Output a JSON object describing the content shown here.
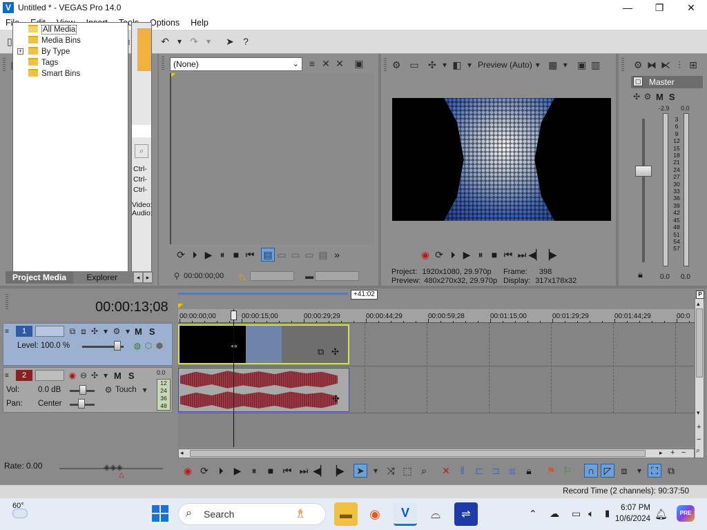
{
  "window": {
    "title": "Untitled * - VEGAS Pro 14.0",
    "logo": "V",
    "minimize_glyph": "—",
    "maximize_glyph": "❐",
    "close_glyph": "✕"
  },
  "menu": [
    "File",
    "Edit",
    "View",
    "Insert",
    "Tools",
    "Options",
    "Help"
  ],
  "toolbar_icons": [
    "new-icon",
    "open-icon",
    "save-icon",
    "save-as-icon",
    "render-icon",
    "properties-icon",
    "cut-icon",
    "copy-icon",
    "paste-icon",
    "undo-icon",
    "redo-icon",
    "cursor-icon",
    "help-icon"
  ],
  "project_media": {
    "tree": [
      {
        "label": "All Media",
        "selected": true
      },
      {
        "label": "Media Bins"
      },
      {
        "label": "By Type",
        "expand": "+"
      },
      {
        "label": "Tags"
      },
      {
        "label": "Smart Bins"
      }
    ],
    "thumb_lines": [
      "Ctrl-",
      "Ctrl-",
      "Ctrl-"
    ],
    "video_label": "Video:",
    "audio_label": "Audio:",
    "tabs": [
      "Project Media",
      "Explorer"
    ]
  },
  "trimmer": {
    "selector": "(None)",
    "timecode": "00:00:00;00"
  },
  "preview": {
    "mode": "Preview (Auto)",
    "project_label": "Project:",
    "project_value": "1920x1080, 29.970p",
    "preview_label": "Preview:",
    "preview_value": "480x270x32, 29.970p",
    "frame_label": "Frame:",
    "frame_value": "398",
    "display_label": "Display:",
    "display_value": "317x178x32"
  },
  "mixer": {
    "master": "Master",
    "m": "M",
    "s": "S",
    "peak_left": "-2.9",
    "peak_right": "0.0",
    "scale": [
      "3",
      "6",
      "9",
      "12",
      "15",
      "18",
      "21",
      "24",
      "27",
      "30",
      "33",
      "36",
      "39",
      "42",
      "45",
      "48",
      "51",
      "54",
      "57"
    ],
    "bottom_left": "0.0",
    "bottom_right": "0.0"
  },
  "timeline": {
    "timecode": "00:00:13;08",
    "loop_length": "+41:02",
    "ruler": [
      "00:00:00;00",
      "00:00:15;00",
      "00:00:29;29",
      "00:00:44;29",
      "00:00:59;28",
      "00:01:15;00",
      "00:01:29;29",
      "00:01:44;29",
      "00:0"
    ],
    "video_track": {
      "number": "1",
      "m": "M",
      "s": "S",
      "level": "Level: 100.0 %"
    },
    "audio_track": {
      "number": "2",
      "m": "M",
      "s": "S",
      "vol_label": "Vol:",
      "vol_value": "0.0 dB",
      "pan_label": "Pan:",
      "pan_value": "Center",
      "touch": "Touch",
      "meter_top": "0.0",
      "meter_scale": [
        "12",
        "24",
        "36",
        "48"
      ]
    },
    "rate": "Rate: 0.00"
  },
  "status": {
    "record_time": "Record Time (2 channels): 90:37:50"
  },
  "taskbar": {
    "weather": "60°",
    "search": "Search",
    "time": "6:07 PM",
    "date": "10/6/2024",
    "pre_badge": "PRE"
  }
}
